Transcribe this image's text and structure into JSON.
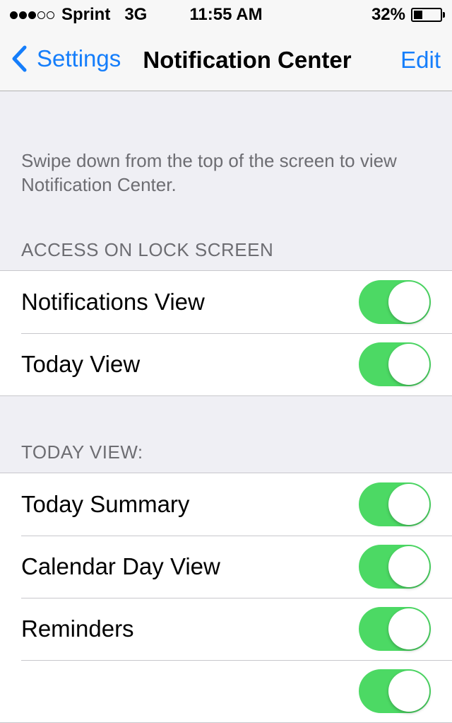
{
  "status_bar": {
    "carrier": "Sprint",
    "network": "3G",
    "time": "11:55 AM",
    "battery_text": "32%",
    "battery_level": 0.32,
    "signal_bars_filled": 3,
    "signal_bars_total": 5
  },
  "nav": {
    "back_label": "Settings",
    "title": "Notification Center",
    "edit_label": "Edit"
  },
  "description": "Swipe down from the top of the screen to view Notification Center.",
  "lock_screen": {
    "header": "ACCESS ON LOCK SCREEN",
    "rows": [
      {
        "label": "Notifications View",
        "on": true
      },
      {
        "label": "Today View",
        "on": true
      }
    ]
  },
  "today_view": {
    "header": "TODAY VIEW:",
    "rows": [
      {
        "label": "Today Summary",
        "on": true
      },
      {
        "label": "Calendar Day View",
        "on": true
      },
      {
        "label": "Reminders",
        "on": true
      },
      {
        "label": "",
        "on": true
      }
    ]
  },
  "colors": {
    "accent": "#157efb",
    "toggle_on": "#4cd964",
    "background": "#efeff4"
  }
}
